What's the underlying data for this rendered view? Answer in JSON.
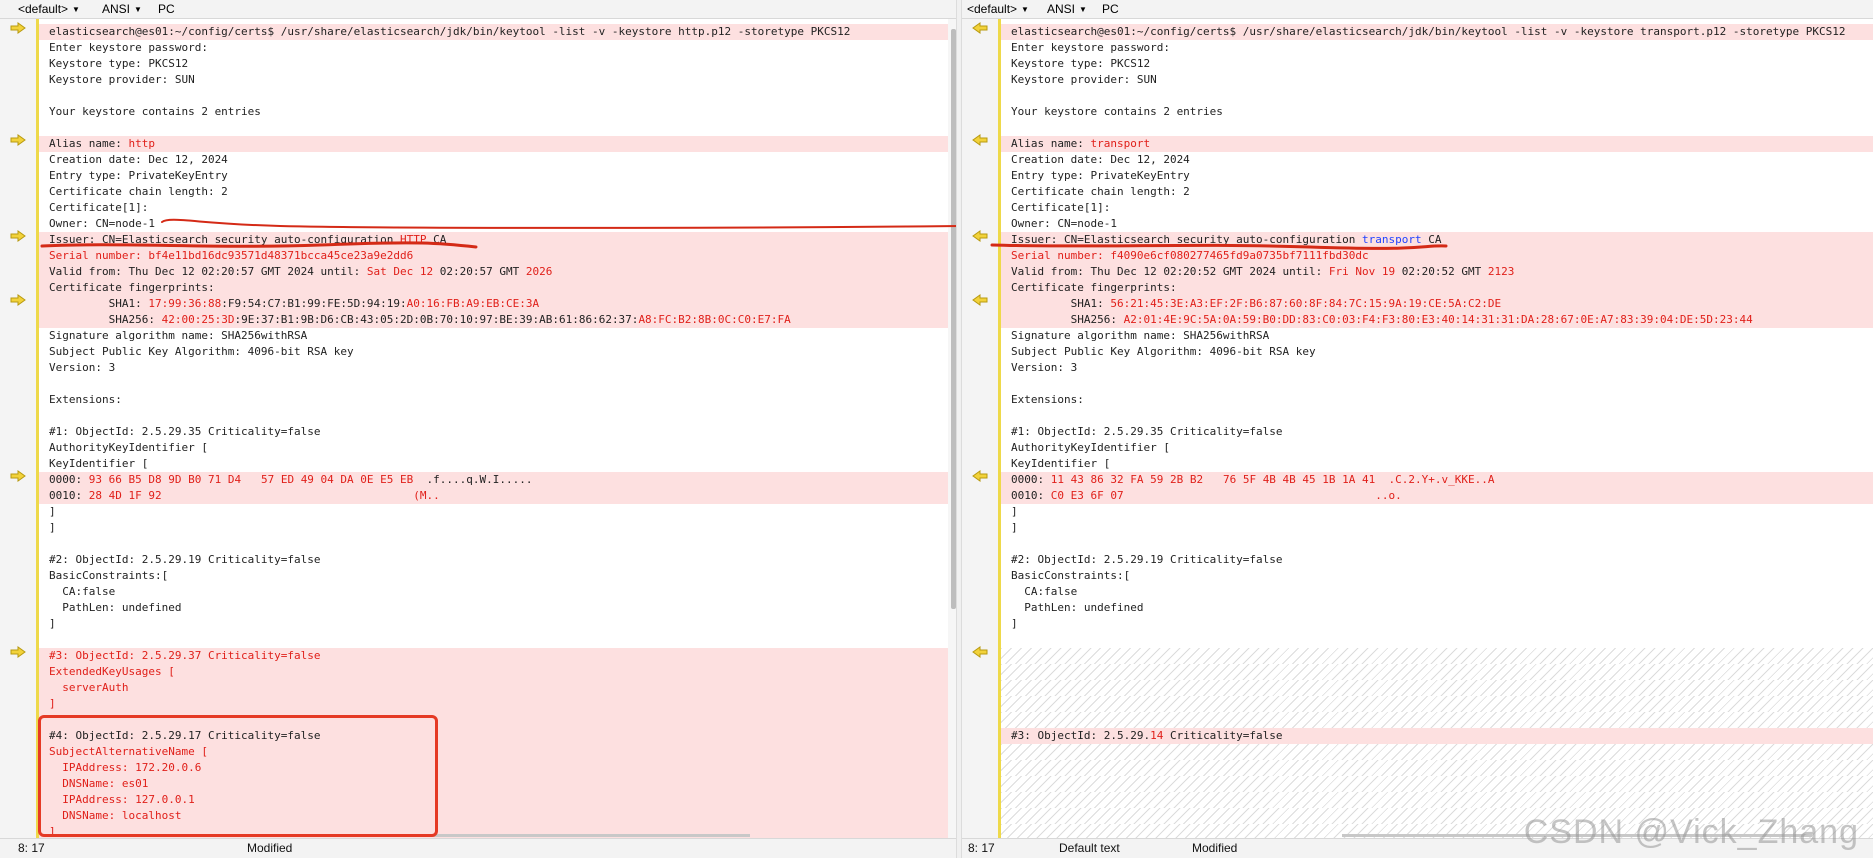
{
  "left": {
    "header": {
      "encoding_profile": "<default>",
      "charset": "ANSI",
      "line_endings": "PC"
    },
    "lines": [
      {
        "text": "elasticsearch@es01:~/config/certs$ /usr/share/elasticsearch/jdk/bin/keytool -list -v -keystore http.p12 -storetype PKCS12",
        "diff": true
      },
      {
        "text": "Enter keystore password:"
      },
      {
        "text": "Keystore type: PKCS12"
      },
      {
        "text": "Keystore provider: SUN"
      },
      {
        "text": ""
      },
      {
        "text": "Your keystore contains 2 entries"
      },
      {
        "text": ""
      },
      {
        "text": "Alias name: http",
        "diff": true
      },
      {
        "text": "Creation date: Dec 12, 2024"
      },
      {
        "text": "Entry type: PrivateKeyEntry"
      },
      {
        "text": "Certificate chain length: 2"
      },
      {
        "text": "Certificate[1]:"
      },
      {
        "text": "Owner: CN=node-1"
      },
      {
        "text": "Issuer: CN=Elasticsearch security auto-configuration HTTP CA",
        "diff": true
      },
      {
        "text": "Serial number: bf4e11bd16dc93571d48371bcca45ce23a9e2dd6",
        "diff": true,
        "red": true
      },
      {
        "text": "Valid from: Thu Dec 12 02:20:57 GMT 2024 until: Sat Dec 12 02:20:57 GMT 2026",
        "diff": true
      },
      {
        "text": "Certificate fingerprints:",
        "diff": true
      },
      {
        "text": "         SHA1: 17:99:36:88:F9:54:C7:B1:99:FE:5D:94:19:A0:16:FB:A9:EB:CE:3A",
        "diff": true
      },
      {
        "text": "         SHA256: 42:00:25:3D:9E:37:B1:9B:D6:CB:43:05:2D:0B:70:10:97:BE:39:AB:61:86:62:37:A8:FC:B2:8B:0C:C0:E7:FA",
        "diff": true
      },
      {
        "text": "Signature algorithm name: SHA256withRSA"
      },
      {
        "text": "Subject Public Key Algorithm: 4096-bit RSA key"
      },
      {
        "text": "Version: 3"
      },
      {
        "text": ""
      },
      {
        "text": "Extensions:"
      },
      {
        "text": ""
      },
      {
        "text": "#1: ObjectId: 2.5.29.35 Criticality=false"
      },
      {
        "text": "AuthorityKeyIdentifier ["
      },
      {
        "text": "KeyIdentifier ["
      },
      {
        "text": "0000: 93 66 B5 D8 9D B0 71 D4   57 ED 49 04 DA 0E E5 EB  .f....q.W.I.....",
        "diff": true
      },
      {
        "text": "0010: 28 4D 1F 92                                      (M..",
        "diff": true
      },
      {
        "text": "]"
      },
      {
        "text": "]"
      },
      {
        "text": ""
      },
      {
        "text": "#2: ObjectId: 2.5.29.19 Criticality=false"
      },
      {
        "text": "BasicConstraints:["
      },
      {
        "text": "  CA:false"
      },
      {
        "text": "  PathLen: undefined"
      },
      {
        "text": "]"
      },
      {
        "text": ""
      },
      {
        "text": "#3: ObjectId: 2.5.29.37 Criticality=false",
        "diff": true,
        "red": true
      },
      {
        "text": "ExtendedKeyUsages [",
        "diff": true,
        "red": true
      },
      {
        "text": "  serverAuth",
        "diff": true,
        "red": true
      },
      {
        "text": "]",
        "diff": true,
        "red": true
      },
      {
        "text": "",
        "diff": true
      },
      {
        "text": "#4: ObjectId: 2.5.29.17 Criticality=false",
        "diff": true
      },
      {
        "text": "SubjectAlternativeName [",
        "diff": true,
        "red": true
      },
      {
        "text": "  IPAddress: 172.20.0.6",
        "diff": true,
        "red": true
      },
      {
        "text": "  DNSName: es01",
        "diff": true,
        "red": true
      },
      {
        "text": "  IPAddress: 127.0.0.1",
        "diff": true,
        "red": true
      },
      {
        "text": "  DNSName: localhost",
        "diff": true,
        "red": true
      },
      {
        "text": "]",
        "diff": true,
        "red": true
      }
    ],
    "status": {
      "position": "8: 17",
      "state": "Modified"
    }
  },
  "right": {
    "header": {
      "encoding_profile": "<default>",
      "charset": "ANSI",
      "line_endings": "PC"
    },
    "lines": [
      {
        "text": "elasticsearch@es01:~/config/certs$ /usr/share/elasticsearch/jdk/bin/keytool -list -v -keystore transport.p12 -storetype PKCS12",
        "diff": true
      },
      {
        "text": "Enter keystore password:"
      },
      {
        "text": "Keystore type: PKCS12"
      },
      {
        "text": "Keystore provider: SUN"
      },
      {
        "text": ""
      },
      {
        "text": "Your keystore contains 2 entries"
      },
      {
        "text": ""
      },
      {
        "text": "Alias name: transport",
        "diff": true
      },
      {
        "text": "Creation date: Dec 12, 2024"
      },
      {
        "text": "Entry type: PrivateKeyEntry"
      },
      {
        "text": "Certificate chain length: 2"
      },
      {
        "text": "Certificate[1]:"
      },
      {
        "text": "Owner: CN=node-1"
      },
      {
        "text": "Issuer: CN=Elasticsearch security auto-configuration transport CA",
        "diff": true
      },
      {
        "text": "Serial number: f4090e6cf080277465fd9a0735bf7111fbd30dc",
        "diff": true,
        "red": true
      },
      {
        "text": "Valid from: Thu Dec 12 02:20:52 GMT 2024 until: Fri Nov 19 02:20:52 GMT 2123",
        "diff": true
      },
      {
        "text": "Certificate fingerprints:",
        "diff": true
      },
      {
        "text": "         SHA1: 56:21:45:3E:A3:EF:2F:B6:87:60:8F:84:7C:15:9A:19:CE:5A:C2:DE",
        "diff": true
      },
      {
        "text": "         SHA256: A2:01:4E:9C:5A:0A:59:B0:DD:83:C0:03:F4:F3:80:E3:40:14:31:31:DA:28:67:0E:A7:83:39:04:DE:5D:23:44",
        "diff": true
      },
      {
        "text": "Signature algorithm name: SHA256withRSA"
      },
      {
        "text": "Subject Public Key Algorithm: 4096-bit RSA key"
      },
      {
        "text": "Version: 3"
      },
      {
        "text": ""
      },
      {
        "text": "Extensions:"
      },
      {
        "text": ""
      },
      {
        "text": "#1: ObjectId: 2.5.29.35 Criticality=false"
      },
      {
        "text": "AuthorityKeyIdentifier ["
      },
      {
        "text": "KeyIdentifier ["
      },
      {
        "text": "0000: 11 43 86 32 FA 59 2B B2   76 5F 4B 4B 45 1B 1A 41  .C.2.Y+.v_KKE..A",
        "diff": true
      },
      {
        "text": "0010: C0 E3 6F 07                                      ..o.",
        "diff": true
      },
      {
        "text": "]"
      },
      {
        "text": "]"
      },
      {
        "text": ""
      },
      {
        "text": "#2: ObjectId: 2.5.29.19 Criticality=false"
      },
      {
        "text": "BasicConstraints:["
      },
      {
        "text": "  CA:false"
      },
      {
        "text": "  PathLen: undefined"
      },
      {
        "text": "]"
      },
      {
        "text": ""
      },
      {
        "text": "",
        "hatch": true
      },
      {
        "text": "",
        "hatch": true
      },
      {
        "text": "",
        "hatch": true
      },
      {
        "text": "",
        "hatch": true
      },
      {
        "text": "",
        "hatch": true
      },
      {
        "text": "#3: ObjectId: 2.5.29.14 Criticality=false",
        "diff": true
      },
      {
        "text": "",
        "hatch": true
      },
      {
        "text": "",
        "hatch": true
      },
      {
        "text": "",
        "hatch": true
      },
      {
        "text": "",
        "hatch": true
      },
      {
        "text": "",
        "hatch": true
      },
      {
        "text": "",
        "hatch": true
      }
    ],
    "status": {
      "position": "8: 17",
      "mode": "Default text",
      "state": "Modified"
    }
  },
  "watermark": "CSDN @Vick_Zhang"
}
